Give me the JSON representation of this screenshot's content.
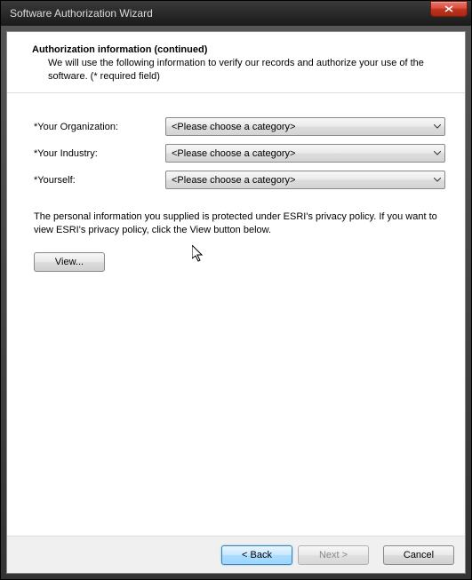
{
  "window": {
    "title": "Software Authorization Wizard"
  },
  "header": {
    "heading": "Authorization information (continued)",
    "subheading": "We will use the following information to verify our records and authorize your use of the software. (* required field)"
  },
  "form": {
    "rows": [
      {
        "label": "*Your Organization:",
        "value": "<Please choose a category>"
      },
      {
        "label": "*Your Industry:",
        "value": "<Please choose a category>"
      },
      {
        "label": "*Yourself:",
        "value": "<Please choose a category>"
      }
    ],
    "privacy_text": "The personal information you supplied is protected under ESRI's privacy policy. If you want to view ESRI's privacy policy, click the View button below.",
    "view_button": "View..."
  },
  "buttons": {
    "back": "< Back",
    "next": "Next >",
    "cancel": "Cancel"
  }
}
